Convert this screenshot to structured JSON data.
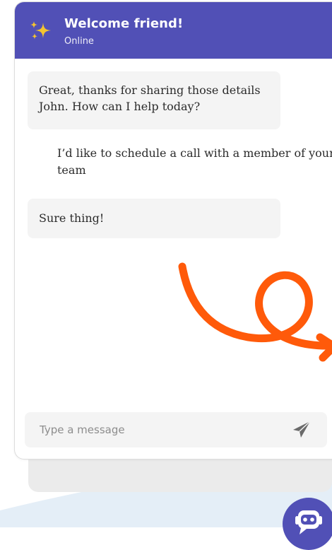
{
  "header": {
    "title": "Welcome friend!",
    "status": "Online",
    "icon": "sparkles-icon"
  },
  "messages": [
    {
      "sender": "bot",
      "text": "Great, thanks for sharing those details John. How can I help today?"
    },
    {
      "sender": "user",
      "text": "I’d like to schedule a call with a member of your team"
    },
    {
      "sender": "bot",
      "text": "Sure thing!"
    }
  ],
  "composer": {
    "placeholder": "Type a message",
    "value": "",
    "send_icon": "send-icon"
  },
  "launcher": {
    "icon": "chatbot-icon"
  },
  "colors": {
    "header_bg": "#5150b6",
    "accent_squiggle": "#ff5a0a",
    "bubble_bg": "#f4f4f4",
    "launcher_bg": "#5150b6",
    "sparkle": "#f4c430"
  }
}
